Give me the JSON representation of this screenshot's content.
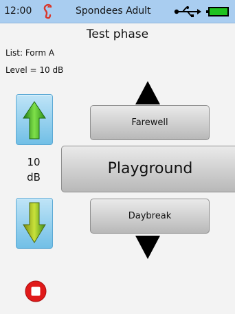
{
  "status_bar": {
    "time": "12:00",
    "title": "Spondees Adult",
    "icons": [
      "ear-icon",
      "usb-icon",
      "battery-icon"
    ]
  },
  "header": {
    "title": "Test phase"
  },
  "info": {
    "list": "List: Form A",
    "level": "Level =  10 dB"
  },
  "level_control": {
    "value": "10",
    "unit": "dB",
    "up_icon": "arrow-up-icon",
    "down_icon": "arrow-down-icon"
  },
  "words": {
    "previous": "Farewell",
    "current": "Playground",
    "next": "Daybreak"
  },
  "colors": {
    "statusbar": "#a9cdf0",
    "arrow_green": "#3aa61f",
    "stop_red": "#e01a1a",
    "battery_green": "#1fc21f"
  }
}
